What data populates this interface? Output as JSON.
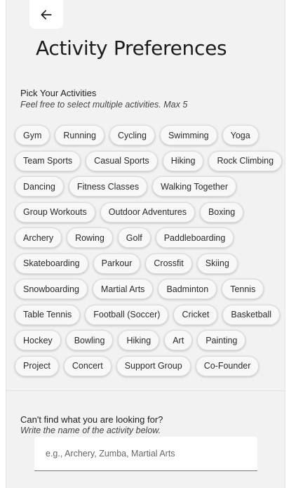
{
  "header": {
    "back_icon": "arrow-left-icon",
    "title": "Activity Preferences"
  },
  "pick_section": {
    "heading": "Pick Your Activities",
    "subheading": "Feel free to select multiple activities. Max 5"
  },
  "activity_rows": [
    [
      "Gym",
      "Running",
      "Cycling",
      "Swimming",
      "Yoga"
    ],
    [
      "Team Sports",
      "Casual Sports",
      "Hiking",
      "Rock Climbing"
    ],
    [
      "Dancing",
      "Fitness Classes",
      "Walking Together"
    ],
    [
      "Group Workouts",
      "Outdoor Adventures",
      "Boxing"
    ],
    [
      "Archery",
      "Rowing",
      "Golf",
      "Paddleboarding"
    ],
    [
      "Skateboarding",
      "Parkour",
      "Crossfit",
      "Skiing"
    ],
    [
      "Snowboarding",
      "Martial Arts",
      "Badminton",
      "Tennis"
    ],
    [
      "Table Tennis",
      "Football (Soccer)",
      "Cricket",
      "Basketball"
    ],
    [
      "Hockey",
      "Bowling",
      "Hiking",
      "Art",
      "Painting"
    ],
    [
      "Project",
      "Concert",
      "Support Group",
      "Co-Founder"
    ]
  ],
  "custom_section": {
    "heading": "Can't find what you are looking for?",
    "subheading": "Write the name of the activity below.",
    "input_value": "",
    "input_placeholder": "e.g., Archery, Zumba, Martial Arts"
  }
}
